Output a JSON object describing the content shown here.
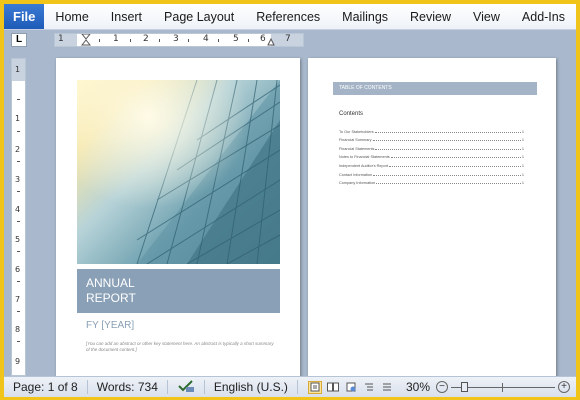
{
  "ribbon": {
    "file_label": "File",
    "tabs": [
      "Home",
      "Insert",
      "Page Layout",
      "References",
      "Mailings",
      "Review",
      "View",
      "Add-Ins"
    ]
  },
  "ruler": {
    "corner_label": "L",
    "h_numbers": [
      "1",
      "1",
      "1",
      "2",
      "3",
      "4",
      "5",
      "6",
      "7"
    ],
    "v_numbers": [
      "1",
      "1",
      "2",
      "3",
      "4",
      "5",
      "6",
      "7",
      "8",
      "9"
    ]
  },
  "page1": {
    "title_line1": "ANNUAL",
    "title_line2": "REPORT",
    "fy": "FY [YEAR]",
    "abstract": "[You can add an abstract or other key statement here. An abstract is typically a short summary of the document content.]"
  },
  "page2": {
    "toc_header": "TABLE OF CONTENTS",
    "contents_label": "Contents",
    "toc_items": [
      {
        "label": "To Our Stakeholders",
        "page": "1"
      },
      {
        "label": "Financial Summary",
        "page": "1"
      },
      {
        "label": "Financial Statements",
        "page": "1"
      },
      {
        "label": "Notes to Financial Statements",
        "page": "1"
      },
      {
        "label": "Independent Auditor's Report",
        "page": "1"
      },
      {
        "label": "Contact Information",
        "page": "1"
      },
      {
        "label": "Company Information",
        "page": "1"
      }
    ]
  },
  "statusbar": {
    "page": "Page: 1 of 8",
    "words": "Words: 734",
    "language": "English (U.S.)",
    "zoom": "30%",
    "zoom_level_percent": 30
  },
  "colors": {
    "frame": "#f0c419",
    "file_tab": "#1e5bb8",
    "title_box": "#8aa0b6",
    "toc_bar": "#a4b4c6"
  },
  "icons": [
    "spellcheck-icon",
    "print-layout-icon",
    "full-screen-reading-icon",
    "web-layout-icon",
    "outline-icon",
    "draft-icon",
    "zoom-out-icon",
    "zoom-in-icon"
  ]
}
